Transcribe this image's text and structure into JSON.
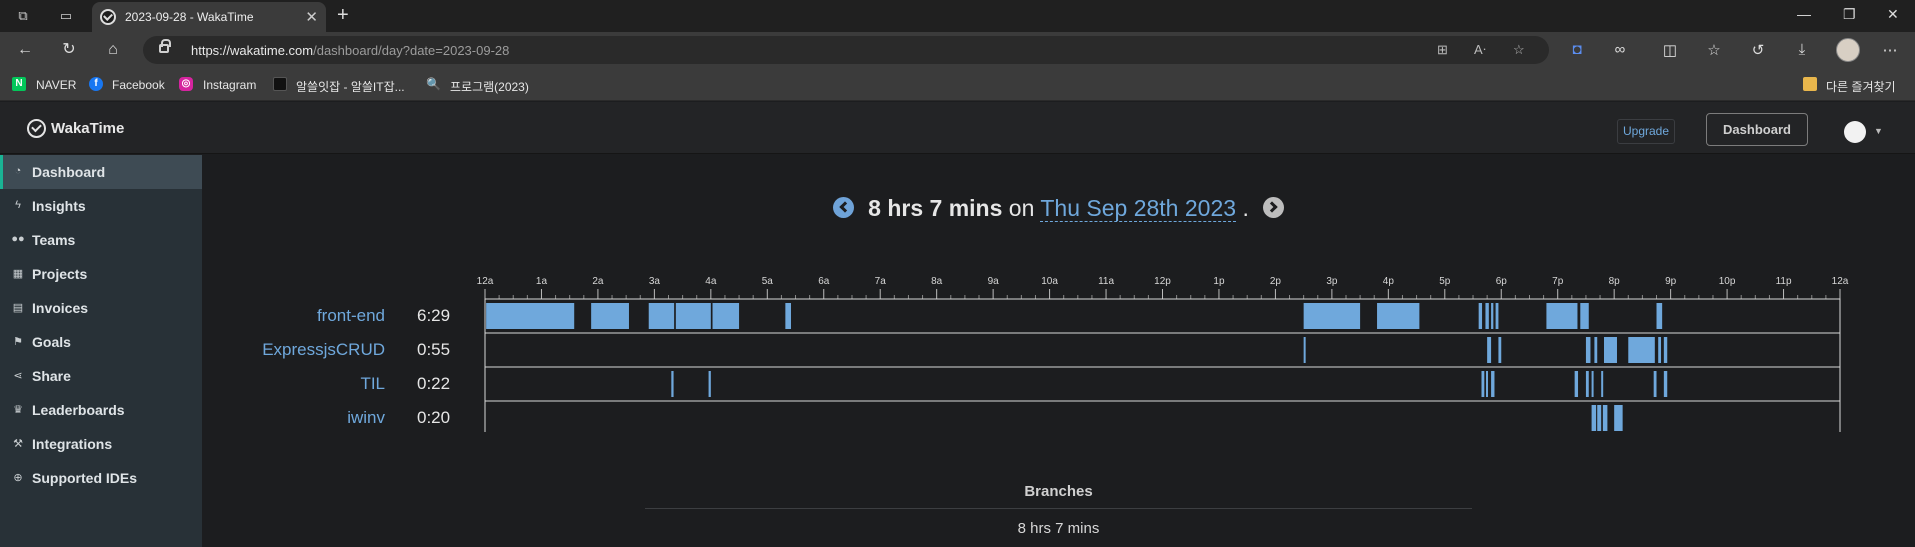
{
  "browser": {
    "tab_title": "2023-09-28 - WakaTime",
    "url_host": "https://wakatime.com",
    "url_path": "/dashboard/day?date=2023-09-28",
    "bookmarks": [
      {
        "label": "NAVER",
        "icon": "naver-icon",
        "color": "#03c75a"
      },
      {
        "label": "Facebook",
        "icon": "facebook-icon",
        "color": "#1877f2"
      },
      {
        "label": "Instagram",
        "icon": "instagram-icon",
        "color": "#d6249f"
      },
      {
        "label": "알쓸잇잡 - 알쓸IT잡...",
        "icon": "site-icon",
        "color": "#111111"
      },
      {
        "label": "프로그램(2023)",
        "icon": "search-icon",
        "color": "#cccccc"
      }
    ],
    "other_bookmarks": "다른 즐겨찾기"
  },
  "header": {
    "brand": "WakaTime",
    "upgrade_label": "Upgrade",
    "dashboard_label": "Dashboard"
  },
  "sidebar": {
    "items": [
      {
        "label": "Dashboard",
        "icon": "tachometer-icon",
        "active": true
      },
      {
        "label": "Insights",
        "icon": "bolt-icon"
      },
      {
        "label": "Teams",
        "icon": "users-icon"
      },
      {
        "label": "Projects",
        "icon": "grid-icon"
      },
      {
        "label": "Invoices",
        "icon": "file-icon"
      },
      {
        "label": "Goals",
        "icon": "flag-icon"
      },
      {
        "label": "Share",
        "icon": "share-icon"
      },
      {
        "label": "Leaderboards",
        "icon": "trophy-icon"
      },
      {
        "label": "Integrations",
        "icon": "wrench-icon"
      },
      {
        "label": "Supported IDEs",
        "icon": "plus-circle-icon"
      }
    ]
  },
  "day": {
    "total": "8 hrs 7 mins",
    "on": "on",
    "date_label": "Thu Sep 28th 2023",
    "period": "."
  },
  "colors": {
    "bar": "#6fa8dc",
    "accent": "#1ab394"
  },
  "chart_data": {
    "type": "timeline",
    "x_ticks": [
      "12a",
      "1a",
      "2a",
      "3a",
      "4a",
      "5a",
      "6a",
      "7a",
      "8a",
      "9a",
      "10a",
      "11a",
      "12p",
      "1p",
      "2p",
      "3p",
      "4p",
      "5p",
      "6p",
      "7p",
      "8p",
      "9p",
      "10p",
      "11p",
      "12a"
    ],
    "x_unit": "hour of day",
    "xlim": [
      0,
      24
    ],
    "series": [
      {
        "name": "front-end",
        "total": "6:29",
        "segments": [
          [
            0.02,
            1.58
          ],
          [
            1.88,
            2.55
          ],
          [
            2.9,
            3.35
          ],
          [
            3.38,
            4.0
          ],
          [
            4.03,
            4.5
          ],
          [
            5.32,
            5.42
          ],
          [
            14.5,
            15.5
          ],
          [
            15.8,
            16.55
          ],
          [
            17.6,
            17.66
          ],
          [
            17.72,
            17.78
          ],
          [
            17.82,
            17.86
          ],
          [
            17.9,
            17.95
          ],
          [
            18.8,
            19.35
          ],
          [
            19.4,
            19.55
          ],
          [
            20.75,
            20.85
          ]
        ]
      },
      {
        "name": "ExpressjsCRUD",
        "total": "0:55",
        "segments": [
          [
            14.5,
            14.52
          ],
          [
            17.75,
            17.82
          ],
          [
            17.95,
            18.0
          ],
          [
            19.5,
            19.58
          ],
          [
            19.65,
            19.7
          ],
          [
            19.82,
            20.05
          ],
          [
            20.25,
            20.72
          ],
          [
            20.78,
            20.83
          ],
          [
            20.88,
            20.94
          ]
        ]
      },
      {
        "name": "TIL",
        "total": "0:22",
        "segments": [
          [
            3.3,
            3.34
          ],
          [
            3.96,
            4.0
          ],
          [
            17.65,
            17.7
          ],
          [
            17.73,
            17.76
          ],
          [
            17.82,
            17.88
          ],
          [
            19.3,
            19.36
          ],
          [
            19.5,
            19.55
          ],
          [
            19.6,
            19.62
          ],
          [
            19.77,
            19.8
          ],
          [
            20.7,
            20.75
          ],
          [
            20.88,
            20.94
          ]
        ]
      },
      {
        "name": "iwinv",
        "total": "0:20",
        "segments": [
          [
            19.6,
            19.68
          ],
          [
            19.7,
            19.77
          ],
          [
            19.8,
            19.88
          ],
          [
            20.0,
            20.15
          ]
        ]
      }
    ]
  },
  "branches": {
    "title": "Branches",
    "total": "8 hrs 7 mins"
  }
}
